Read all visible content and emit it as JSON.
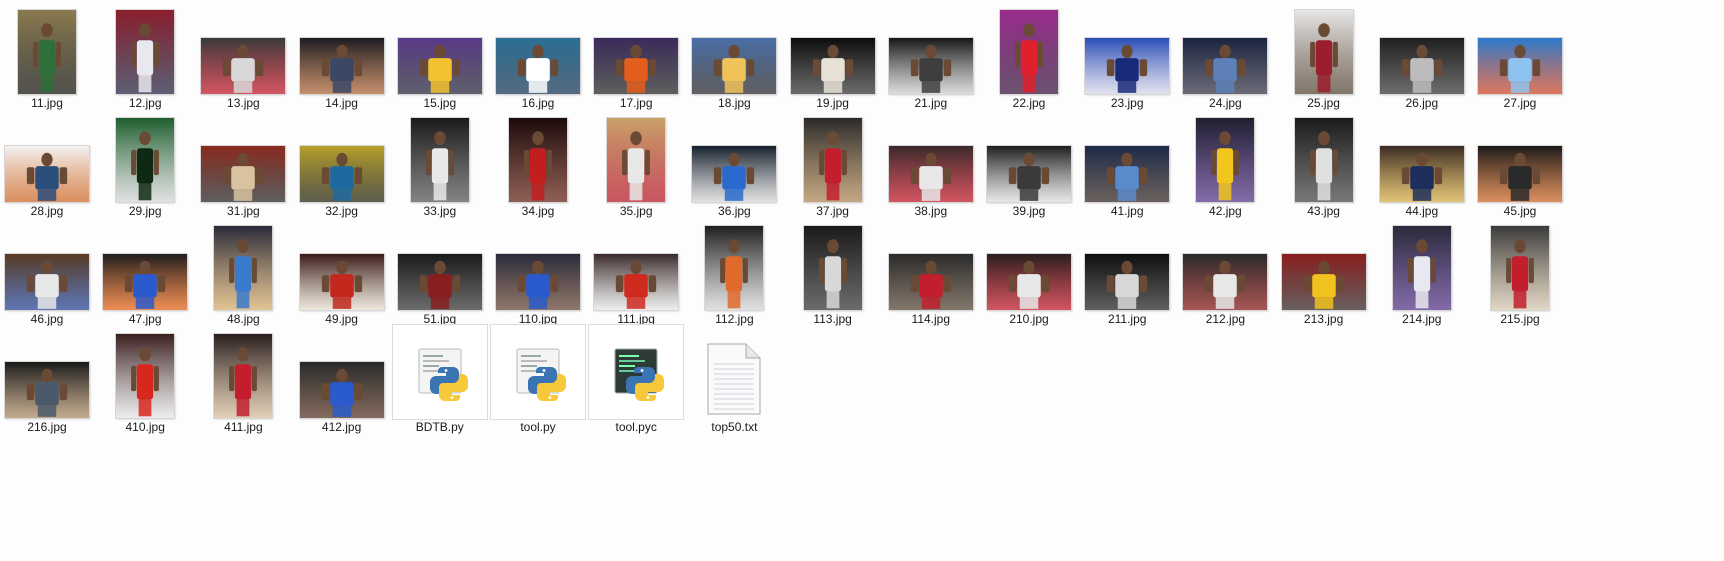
{
  "window": {
    "view_mode": "Large icons",
    "background": "#fdfdfd"
  },
  "items": [
    {
      "name": "11.jpg",
      "kind": "image",
      "shape": "portrait",
      "colors": [
        "#8a7a4e",
        "#2e6f3a",
        "#1a1a14"
      ],
      "subject": "player holding trophy"
    },
    {
      "name": "12.jpg",
      "kind": "image",
      "shape": "portrait",
      "colors": [
        "#8b1e2c",
        "#e8e8ee",
        "#2a2a46"
      ],
      "subject": "76ers player number 1"
    },
    {
      "name": "13.jpg",
      "kind": "image",
      "shape": "wide",
      "colors": [
        "#3a3a3a",
        "#d8d8d8",
        "#c21e2e"
      ],
      "subject": "player layup"
    },
    {
      "name": "14.jpg",
      "kind": "image",
      "shape": "wide",
      "colors": [
        "#1c1c22",
        "#3a4866",
        "#b06a3c"
      ],
      "subject": "player dribbling"
    },
    {
      "name": "15.jpg",
      "kind": "image",
      "shape": "wide",
      "colors": [
        "#5b3a8a",
        "#f2c230",
        "#2b2b3c"
      ],
      "subject": "Lakers number 16"
    },
    {
      "name": "16.jpg",
      "kind": "image",
      "shape": "wide",
      "colors": [
        "#2a6f95",
        "#ffffff",
        "#1d3b5a"
      ],
      "subject": "player number 11 back"
    },
    {
      "name": "17.jpg",
      "kind": "image",
      "shape": "wide",
      "colors": [
        "#3b2a5c",
        "#e35e1c",
        "#2a2a2a"
      ],
      "subject": "Suns player dribbling"
    },
    {
      "name": "18.jpg",
      "kind": "image",
      "shape": "wide",
      "colors": [
        "#4a6fa8",
        "#f0c25a",
        "#2c2c30"
      ],
      "subject": "Nuggets players"
    },
    {
      "name": "19.jpg",
      "kind": "image",
      "shape": "wide",
      "colors": [
        "#0c0c0c",
        "#e8e2d6",
        "#3a3a3a"
      ],
      "subject": "player number 11 pointing"
    },
    {
      "name": "21.jpg",
      "kind": "image",
      "shape": "wide",
      "colors": [
        "#161616",
        "#3e3e3e",
        "#d0d0d0"
      ],
      "subject": "dark court action"
    },
    {
      "name": "22.jpg",
      "kind": "image",
      "shape": "portrait",
      "colors": [
        "#9a2c8e",
        "#e0202c",
        "#3a1a40"
      ],
      "subject": "person in red"
    },
    {
      "name": "23.jpg",
      "kind": "image",
      "shape": "wide",
      "colors": [
        "#2a4eb8",
        "#1a2a7a",
        "#d8d8e8"
      ],
      "subject": "crowd in blue"
    },
    {
      "name": "24.jpg",
      "kind": "image",
      "shape": "wide",
      "colors": [
        "#1a2440",
        "#5e80b8",
        "#3a3a4a"
      ],
      "subject": "Grizzlies number 50"
    },
    {
      "name": "25.jpg",
      "kind": "image",
      "shape": "portrait",
      "colors": [
        "#e8e8e8",
        "#9a1e2e",
        "#5a4a3a"
      ],
      "subject": "player running"
    },
    {
      "name": "26.jpg",
      "kind": "image",
      "shape": "wide",
      "colors": [
        "#1e1e1e",
        "#bcbcbc",
        "#3c3c3c"
      ],
      "subject": "player dunk"
    },
    {
      "name": "27.jpg",
      "kind": "image",
      "shape": "wide",
      "colors": [
        "#2a7acc",
        "#8fc3ef",
        "#d04a2a"
      ],
      "subject": "overhead court"
    },
    {
      "name": "28.jpg",
      "kind": "image",
      "shape": "wide",
      "colors": [
        "#f4f4f4",
        "#2c4e7a",
        "#d06a2a"
      ],
      "subject": "player holding ball"
    },
    {
      "name": "29.jpg",
      "kind": "image",
      "shape": "portrait",
      "colors": [
        "#1e5e2e",
        "#0f2a14",
        "#d8d8d8"
      ],
      "subject": "Celtics number 9"
    },
    {
      "name": "31.jpg",
      "kind": "image",
      "shape": "wide",
      "colors": [
        "#8a2a1e",
        "#d8c2a0",
        "#2a2a2a"
      ],
      "subject": "crowd action shot"
    },
    {
      "name": "32.jpg",
      "kind": "image",
      "shape": "wide",
      "colors": [
        "#b6a02a",
        "#1e6aa0",
        "#2a2a12"
      ],
      "subject": "Pacers player"
    },
    {
      "name": "33.jpg",
      "kind": "image",
      "shape": "portrait",
      "colors": [
        "#1a1a1a",
        "#e8e8e8",
        "#5a5a5a"
      ],
      "subject": "Nets player"
    },
    {
      "name": "34.jpg",
      "kind": "image",
      "shape": "portrait",
      "colors": [
        "#1a0a0a",
        "#c21e1e",
        "#6a2a1e"
      ],
      "subject": "Heat player"
    },
    {
      "name": "35.jpg",
      "kind": "image",
      "shape": "portrait",
      "colors": [
        "#c8a26a",
        "#e8e8e8",
        "#b81e2e"
      ],
      "subject": "Wizards player dribbling"
    },
    {
      "name": "36.jpg",
      "kind": "image",
      "shape": "wide",
      "colors": [
        "#16202e",
        "#2a6acc",
        "#d8d8d8"
      ],
      "subject": "Mavericks player"
    },
    {
      "name": "37.jpg",
      "kind": "image",
      "shape": "portrait",
      "colors": [
        "#2a2a2a",
        "#c21e2e",
        "#b08a5a"
      ],
      "subject": "player shooting"
    },
    {
      "name": "38.jpg",
      "kind": "image",
      "shape": "wide",
      "colors": [
        "#3a2a2a",
        "#e8e8e8",
        "#c21e2e"
      ],
      "subject": "Bulls number 13"
    },
    {
      "name": "39.jpg",
      "kind": "image",
      "shape": "wide",
      "colors": [
        "#1e1e1e",
        "#3a3a3a",
        "#e0e0e0"
      ],
      "subject": "bearded player"
    },
    {
      "name": "41.jpg",
      "kind": "image",
      "shape": "wide",
      "colors": [
        "#1e2a4a",
        "#5a8acc",
        "#3a2e2a"
      ],
      "subject": "Timberwolves player"
    },
    {
      "name": "42.jpg",
      "kind": "image",
      "shape": "portrait",
      "colors": [
        "#1e1e2e",
        "#f2c61e",
        "#5a3a8a"
      ],
      "subject": "Lakers player pointing"
    },
    {
      "name": "43.jpg",
      "kind": "image",
      "shape": "portrait",
      "colors": [
        "#1a1a1a",
        "#e0e0e0",
        "#4a4a4a"
      ],
      "subject": "Spurs number 21"
    },
    {
      "name": "44.jpg",
      "kind": "image",
      "shape": "wide",
      "colors": [
        "#3a2a22",
        "#1e2e5a",
        "#d8b04a"
      ],
      "subject": "Pacers number 24"
    },
    {
      "name": "45.jpg",
      "kind": "image",
      "shape": "wide",
      "colors": [
        "#1a1a1a",
        "#2a2a2a",
        "#d06a2a"
      ],
      "subject": "player number 9"
    },
    {
      "name": "46.jpg",
      "kind": "image",
      "shape": "wide",
      "colors": [
        "#5a3a22",
        "#e8e8e8",
        "#2a4a9a"
      ],
      "subject": "Warriors player"
    },
    {
      "name": "47.jpg",
      "kind": "image",
      "shape": "wide",
      "colors": [
        "#1e1e1e",
        "#2a5acc",
        "#e86a1e"
      ],
      "subject": "Knicks number 7"
    },
    {
      "name": "48.jpg",
      "kind": "image",
      "shape": "portrait",
      "colors": [
        "#2a2a3a",
        "#3a7acc",
        "#d8b070"
      ],
      "subject": "Thunder player dribbling"
    },
    {
      "name": "49.jpg",
      "kind": "image",
      "shape": "wide",
      "colors": [
        "#3a1a1a",
        "#c2281e",
        "#e8e0d0"
      ],
      "subject": "Rockets number 12"
    },
    {
      "name": "51.jpg",
      "kind": "image",
      "shape": "wide",
      "colors": [
        "#1a1a1a",
        "#8a1e1e",
        "#3a3a3a"
      ],
      "subject": "Heat player"
    },
    {
      "name": "110.jpg",
      "kind": "image",
      "shape": "wide",
      "colors": [
        "#2a2a3a",
        "#2a5acc",
        "#6a4a3a"
      ],
      "subject": "player holding ball"
    },
    {
      "name": "111.jpg",
      "kind": "image",
      "shape": "wide",
      "colors": [
        "#3a2a2a",
        "#d02a1e",
        "#e8e8e8"
      ],
      "subject": "Hawks number 4"
    },
    {
      "name": "112.jpg",
      "kind": "image",
      "shape": "portrait",
      "colors": [
        "#1e1e1e",
        "#e06a2a",
        "#d8d8d8"
      ],
      "subject": "player with Spalding ball"
    },
    {
      "name": "113.jpg",
      "kind": "image",
      "shape": "portrait",
      "colors": [
        "#1a1a1a",
        "#d8d8d8",
        "#3a3a3a"
      ],
      "subject": "Spurs player"
    },
    {
      "name": "114.jpg",
      "kind": "image",
      "shape": "wide",
      "colors": [
        "#2a2a2a",
        "#c21e2e",
        "#5a4a3a"
      ],
      "subject": "court action"
    },
    {
      "name": "210.jpg",
      "kind": "image",
      "shape": "wide",
      "colors": [
        "#2a1e1e",
        "#e8e8e8",
        "#c21e2e"
      ],
      "subject": "Bulls number 1"
    },
    {
      "name": "211.jpg",
      "kind": "image",
      "shape": "wide",
      "colors": [
        "#0e0e0e",
        "#d8d8d8",
        "#2a2a2a"
      ],
      "subject": "player number 0"
    },
    {
      "name": "212.jpg",
      "kind": "image",
      "shape": "wide",
      "colors": [
        "#2a2a2a",
        "#e8e8e8",
        "#8a1e1e"
      ],
      "subject": "Heat number 1"
    },
    {
      "name": "213.jpg",
      "kind": "image",
      "shape": "wide",
      "colors": [
        "#8a1e1e",
        "#f2c21e",
        "#3a2a2a"
      ],
      "subject": "Cavs number 2"
    },
    {
      "name": "214.jpg",
      "kind": "image",
      "shape": "portrait",
      "colors": [
        "#2a2a3a",
        "#e8e8f0",
        "#5a3a8a"
      ],
      "subject": "player number 1"
    },
    {
      "name": "215.jpg",
      "kind": "image",
      "shape": "portrait",
      "colors": [
        "#3a3a3a",
        "#c21e2e",
        "#d8c8b0"
      ],
      "subject": "Raptors player"
    },
    {
      "name": "216.jpg",
      "kind": "image",
      "shape": "wide",
      "colors": [
        "#1a1a1a",
        "#4a5a6a",
        "#b0906a"
      ],
      "subject": "close-up face"
    },
    {
      "name": "410.jpg",
      "kind": "image",
      "shape": "portrait",
      "colors": [
        "#3a1e1e",
        "#d8281e",
        "#e8e8e8"
      ],
      "subject": "Clippers player"
    },
    {
      "name": "411.jpg",
      "kind": "image",
      "shape": "portrait",
      "colors": [
        "#2a1e1e",
        "#c21e2e",
        "#d8c0a0"
      ],
      "subject": "Clippers player"
    },
    {
      "name": "412.jpg",
      "kind": "image",
      "shape": "wide",
      "colors": [
        "#2a2a2a",
        "#2a5acc",
        "#5a3a2a"
      ],
      "subject": "Thunder number 35"
    },
    {
      "name": "BDTB.py",
      "kind": "py",
      "shape": "file"
    },
    {
      "name": "tool.py",
      "kind": "py",
      "shape": "file"
    },
    {
      "name": "tool.pyc",
      "kind": "pyc",
      "shape": "file"
    },
    {
      "name": "top50.txt",
      "kind": "txt",
      "shape": "file"
    }
  ]
}
